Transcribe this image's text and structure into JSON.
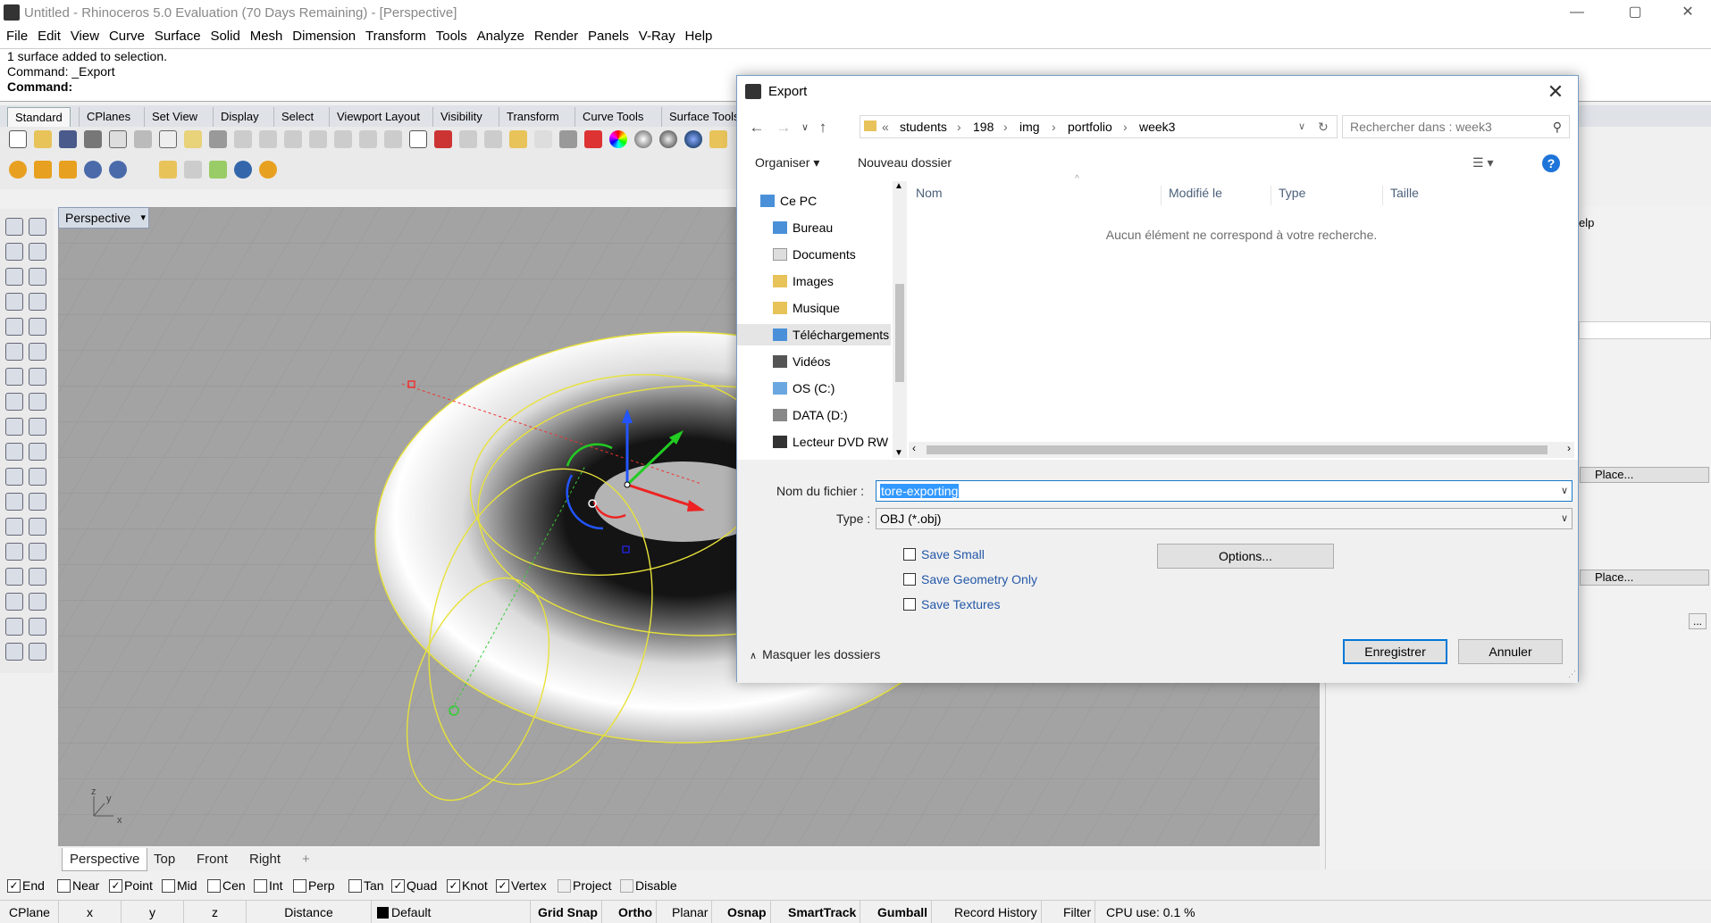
{
  "window": {
    "title": "Untitled - Rhinoceros 5.0 Evaluation (70 Days Remaining) - [Perspective]",
    "minimize": "—",
    "maximize": "▢",
    "close": "✕"
  },
  "menu": [
    "File",
    "Edit",
    "View",
    "Curve",
    "Surface",
    "Solid",
    "Mesh",
    "Dimension",
    "Transform",
    "Tools",
    "Analyze",
    "Render",
    "Panels",
    "V-Ray",
    "Help"
  ],
  "command_history": [
    "1 surface added to selection.",
    "Command: _Export"
  ],
  "command_prompt": "Command:",
  "toolbar_tabs": [
    "Standard",
    "CPlanes",
    "Set View",
    "Display",
    "Select",
    "Viewport Layout",
    "Visibility",
    "Transform",
    "Curve Tools",
    "Surface Tools"
  ],
  "viewport": {
    "label": "Perspective",
    "tabs": [
      "Perspective",
      "Top",
      "Front",
      "Right",
      "+"
    ],
    "axis": {
      "x": "x",
      "y": "y",
      "z": "z"
    }
  },
  "right_panel": {
    "help": "elp",
    "place1": "Place...",
    "place2": "Place...",
    "ellipsis": "..."
  },
  "osnaps": [
    {
      "label": "End",
      "checked": true
    },
    {
      "label": "Near",
      "checked": false
    },
    {
      "label": "Point",
      "checked": true
    },
    {
      "label": "Mid",
      "checked": false
    },
    {
      "label": "Cen",
      "checked": false
    },
    {
      "label": "Int",
      "checked": false
    },
    {
      "label": "Perp",
      "checked": false
    },
    {
      "label": "Tan",
      "checked": false
    },
    {
      "label": "Quad",
      "checked": true
    },
    {
      "label": "Knot",
      "checked": true
    },
    {
      "label": "Vertex",
      "checked": true
    },
    {
      "label": "Project",
      "checked": false
    },
    {
      "label": "Disable",
      "checked": false
    }
  ],
  "status": {
    "cplane": "CPlane",
    "x": "x",
    "y": "y",
    "z": "z",
    "distance": "Distance",
    "layer": "Default",
    "grid_snap": "Grid Snap",
    "ortho": "Ortho",
    "planar": "Planar",
    "osnap": "Osnap",
    "smarttrack": "SmartTrack",
    "gumball": "Gumball",
    "record_history": "Record History",
    "filter": "Filter",
    "cpu": "CPU use: 0.1 %"
  },
  "dialog": {
    "title": "Export",
    "path": [
      "students",
      "198",
      "img",
      "portfolio",
      "week3"
    ],
    "search_placeholder": "Rechercher dans : week3",
    "organize": "Organiser ▾",
    "new_folder": "Nouveau dossier",
    "help": "?",
    "nav_items": [
      {
        "label": "Ce PC",
        "icon": "pc-icon"
      },
      {
        "label": "Bureau",
        "icon": "folder-icon"
      },
      {
        "label": "Documents",
        "icon": "folder-icon"
      },
      {
        "label": "Images",
        "icon": "folder-icon"
      },
      {
        "label": "Musique",
        "icon": "music-folder-icon"
      },
      {
        "label": "Téléchargements",
        "icon": "download-folder-icon",
        "selected": true
      },
      {
        "label": "Vidéos",
        "icon": "folder-icon"
      },
      {
        "label": "OS (C:)",
        "icon": "drive-icon"
      },
      {
        "label": "DATA (D:)",
        "icon": "drive-icon"
      },
      {
        "label": "Lecteur DVD RW",
        "icon": "dvd-icon"
      }
    ],
    "columns": [
      "Nom",
      "Modifié le",
      "Type",
      "Taille"
    ],
    "empty_message": "Aucun élément ne correspond à votre recherche.",
    "filename_label": "Nom du fichier :",
    "filename": "tore-exporting",
    "type_label": "Type :",
    "type": "OBJ (*.obj)",
    "options": [
      {
        "label": "Save Small",
        "checked": false
      },
      {
        "label": "Save Geometry Only",
        "checked": false
      },
      {
        "label": "Save Textures",
        "checked": false
      }
    ],
    "options_button": "Options...",
    "save_button": "Enregistrer",
    "cancel_button": "Annuler",
    "collapse": "Masquer les dossiers"
  }
}
